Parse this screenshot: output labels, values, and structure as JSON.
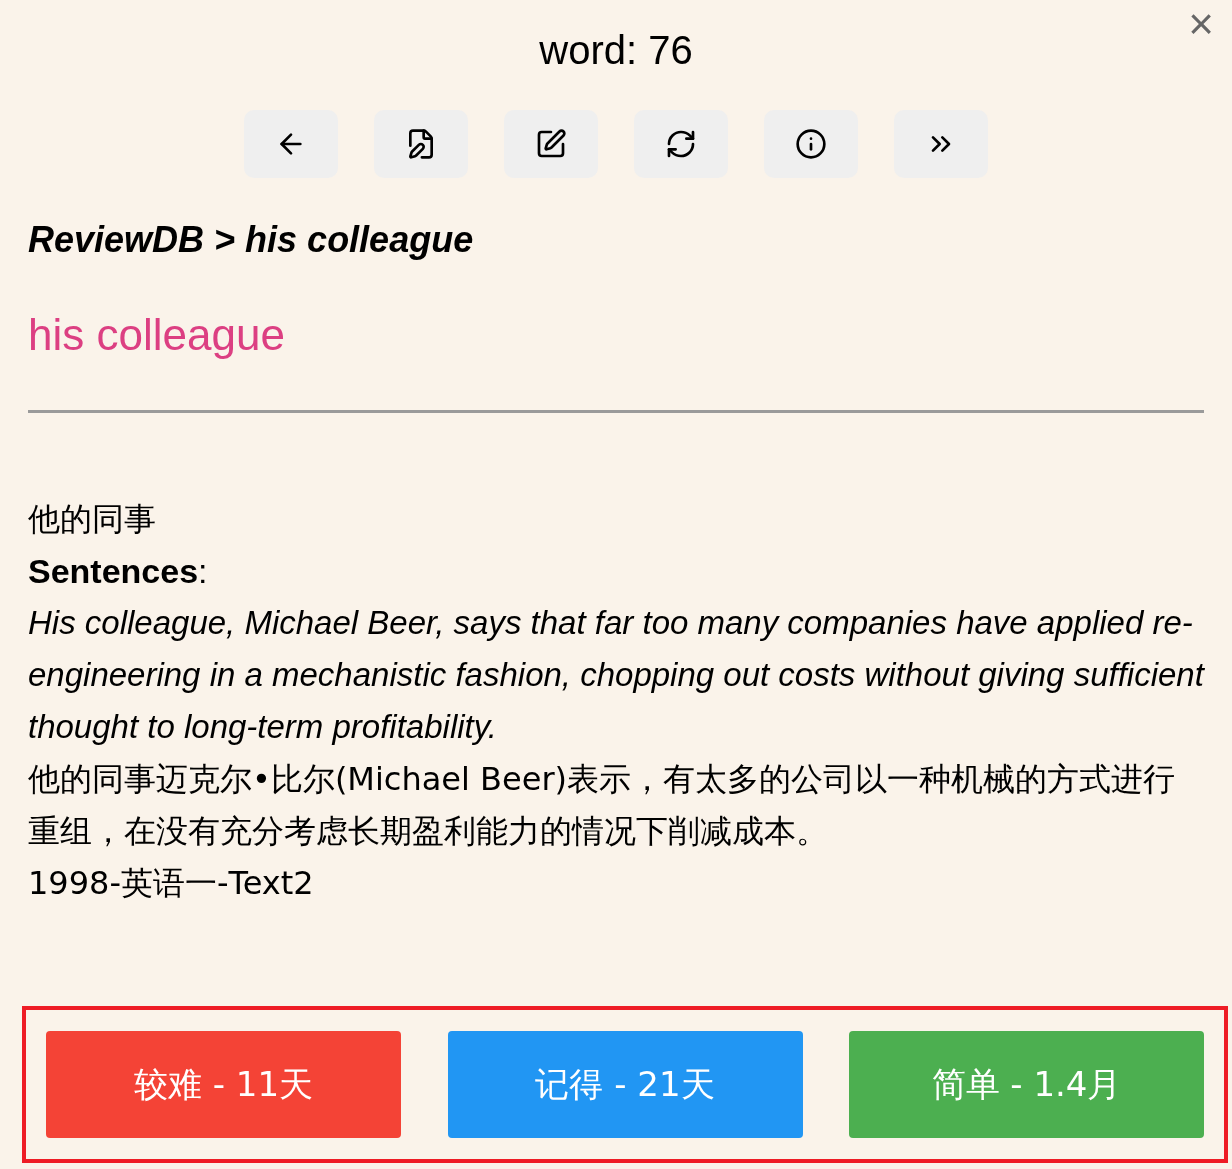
{
  "header": {
    "title": "word: 76",
    "close": "×"
  },
  "breadcrumb": "ReviewDB > his colleague",
  "word": "his colleague",
  "meaning": "他的同事",
  "sentences_label": "**Sentences**:",
  "sentence": "His colleague, Michael Beer, says that far too many companies have applied re-engineering in a mechanistic fashion, chopping out costs without giving sufficient thought to long-term profitability.",
  "translation": "他的同事迈克尔•比尔(Michael Beer)表示，有太多的公司以一种机械的方式进行重组，在没有充分考虑长期盈利能力的情况下削减成本。",
  "source": "1998-英语一-Text2",
  "answers": [
    {
      "label": "较难 - 11天",
      "color": "#f44336"
    },
    {
      "label": "记得 - 21天",
      "color": "#2196f3"
    },
    {
      "label": "简单 - 1.4月",
      "color": "#4caf50"
    }
  ]
}
